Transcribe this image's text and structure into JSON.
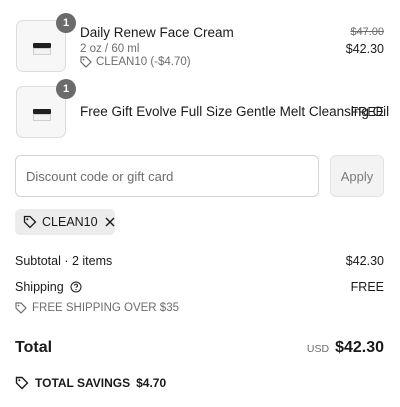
{
  "items": [
    {
      "quantity": "1",
      "name": "Daily Renew Face Cream",
      "variant": "2 oz / 60 ml",
      "discount": "CLEAN10 (-$4.70)",
      "original_price": "$47.00",
      "price": "$42.30",
      "thumbnail_icon": "face-cream-jar"
    },
    {
      "quantity": "1",
      "name": "Free Gift Evolve Full Size Gentle Melt Cleansing Oil",
      "price": "FREE",
      "thumbnail_icon": "cleansing-oil-jar"
    }
  ],
  "discount_form": {
    "placeholder": "Discount code or gift card",
    "value": "",
    "apply_label": "Apply"
  },
  "applied_code": {
    "code": "CLEAN10"
  },
  "summary": {
    "subtotal_label": "Subtotal · 2 items",
    "subtotal_value": "$42.30",
    "shipping_label": "Shipping",
    "shipping_value": "FREE",
    "shipping_note": "FREE SHIPPING OVER $35",
    "total_label": "Total",
    "currency": "USD",
    "total_value": "$42.30",
    "savings_label": "TOTAL SAVINGS",
    "savings_value": "$4.70"
  },
  "colors": {
    "badge": "#6b6b6b",
    "chip_bg": "#ececec",
    "apply_bg": "#f3f3f3"
  }
}
